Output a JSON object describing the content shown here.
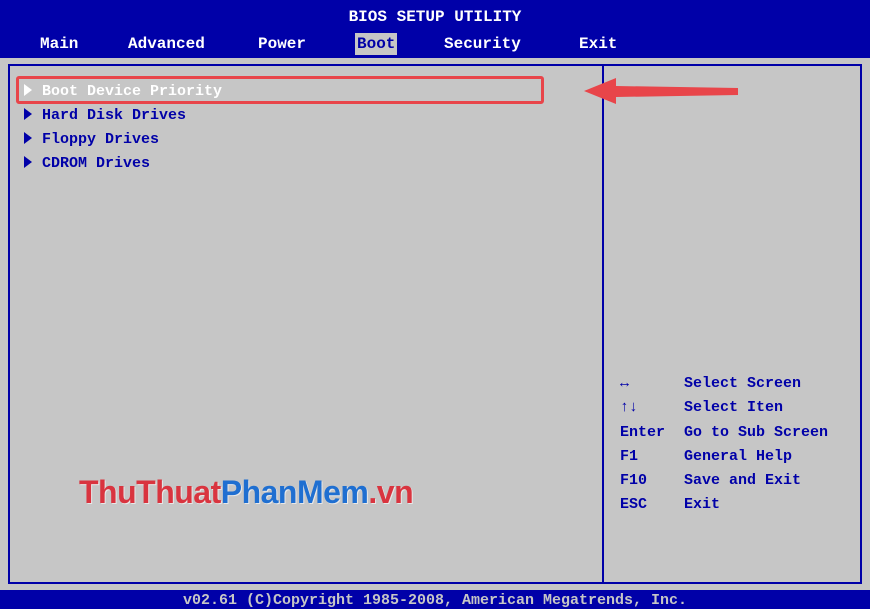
{
  "header": {
    "title": "BIOS SETUP UTILITY",
    "tabs": [
      "Main",
      "Advanced",
      "Power",
      "Boot",
      "Security",
      "Exit"
    ],
    "active_tab": "Boot"
  },
  "boot_menu": {
    "items": [
      "Boot Device Priority",
      "Hard Disk Drives",
      "Floppy Drives",
      "CDROM Drives"
    ],
    "selected": "Boot Device Priority"
  },
  "help": {
    "rows": [
      {
        "key": "↔",
        "desc": "Select Screen"
      },
      {
        "key": "↑↓",
        "desc": "Select Iten"
      },
      {
        "key": "Enter",
        "desc": "Go to Sub Screen"
      },
      {
        "key": "F1",
        "desc": "General Help"
      },
      {
        "key": "F10",
        "desc": "Save and Exit"
      },
      {
        "key": "ESC",
        "desc": "Exit"
      }
    ]
  },
  "watermark": {
    "part1": "ThuThuat",
    "part2": "PhanMem",
    "part3": ".vn"
  },
  "footer": {
    "text": "v02.61 (C)Copyright 1985-2008, American Megatrends, Inc."
  },
  "colors": {
    "bios_blue": "#0000a8",
    "bios_gray": "#c6c6c6",
    "annotation_red": "#e8454a"
  }
}
